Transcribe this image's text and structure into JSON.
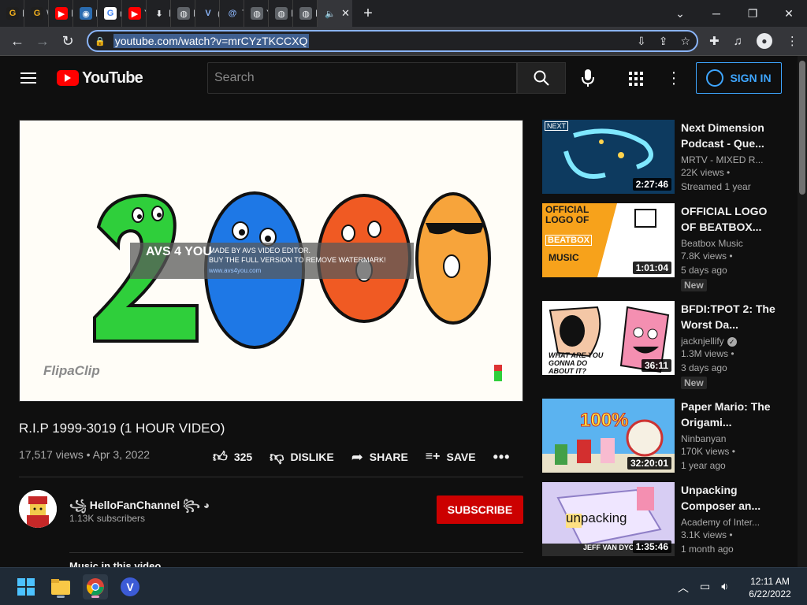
{
  "browser": {
    "tabs": [
      {
        "label": "M",
        "fav": "G",
        "favbg": "#1f1f1f",
        "favcolor": "#f2b01e"
      },
      {
        "label": "W",
        "fav": "G",
        "favbg": "#1f1f1f",
        "favcolor": "#f2b01e"
      },
      {
        "label": "M",
        "fav": "▶",
        "favbg": "#ff0000",
        "favcolor": "#ffffff"
      },
      {
        "label": "Pr",
        "fav": "◉",
        "favbg": "#2b6cb0",
        "favcolor": "#ffffff"
      },
      {
        "label": "m",
        "fav": "G",
        "favbg": "#ffffff",
        "favcolor": "#4285f4"
      },
      {
        "label": "Yo",
        "fav": "▶",
        "favbg": "#ff0000",
        "favcolor": "#ffffff"
      },
      {
        "label": "Do",
        "fav": "⬇",
        "favbg": "#202124",
        "favcolor": "#e8eaed"
      },
      {
        "label": "M",
        "fav": "◍",
        "favbg": "#5f6368",
        "favcolor": "#e8eaed"
      },
      {
        "label": "(1",
        "fav": "V",
        "favbg": "#202124",
        "favcolor": "#8ab4f8"
      },
      {
        "label": "Te",
        "fav": "@",
        "favbg": "#202124",
        "favcolor": "#8ab4f8"
      },
      {
        "label": "Yo",
        "fav": "◍",
        "favbg": "#5f6368",
        "favcolor": "#e8eaed"
      },
      {
        "label": "Re",
        "fav": "◍",
        "favbg": "#5f6368",
        "favcolor": "#e8eaed"
      },
      {
        "label": "Lo",
        "fav": "◍",
        "favbg": "#5f6368",
        "favcolor": "#e8eaed"
      }
    ],
    "active_tab_close": "✕",
    "new_tab": "+",
    "url": "youtube.com/watch?v=mrCYzTKCCXQ"
  },
  "yt": {
    "logo_text": "YouTube",
    "search_placeholder": "Search",
    "signin_label": "SIGN IN"
  },
  "video": {
    "watermark_line1": "MADE BY AVS VIDEO EDITOR.",
    "watermark_line2": "BUY THE FULL VERSION TO REMOVE WATERMARK!",
    "watermark_url": "www.avs4you.com",
    "watermark_logo": "AVS 4 YOU",
    "flipaclip": "FlipaClip",
    "title": "R.I.P 1999-3019 (1 HOUR VIDEO)",
    "views": "17,517 views",
    "date": "Apr 3, 2022",
    "likes": "325",
    "dislike_label": "DISLIKE",
    "share_label": "SHARE",
    "save_label": "SAVE",
    "channel_name": "HelloFanChannel",
    "subscribers": "1.13K subscribers",
    "subscribe_label": "SUBSCRIBE",
    "music_heading": "Music in this video"
  },
  "recommendations": [
    {
      "title": "Next Dimension Podcast - Que...",
      "channel": "MRTV - MIXED R...",
      "views": "22K views •",
      "age": "Streamed 1 year",
      "duration": "2:27:46",
      "badge": "",
      "verified": false
    },
    {
      "title": "OFFICIAL LOGO OF BEATBOX...",
      "channel": "Beatbox Music",
      "views": "7.8K views •",
      "age": "5 days ago",
      "duration": "1:01:04",
      "badge": "New",
      "verified": false
    },
    {
      "title": "BFDI:TPOT 2: The Worst Da...",
      "channel": "jacknjellify",
      "views": "1.3M views •",
      "age": "3 days ago",
      "duration": "36:11",
      "badge": "New",
      "verified": true
    },
    {
      "title": "Paper Mario: The Origami...",
      "channel": "Ninbanyan",
      "views": "170K views •",
      "age": "1 year ago",
      "duration": "32:20:01",
      "badge": "",
      "verified": false
    },
    {
      "title": "Unpacking Composer an...",
      "channel": "Academy of Inter...",
      "views": "3.1K views •",
      "age": "1 month ago",
      "duration": "1:35:46",
      "badge": "",
      "verified": false
    }
  ],
  "thumb_text": {
    "next_logo": "NEXT",
    "beatbox_official": "OFFICIAL LOGO OF",
    "beatbox_word": "BEATBOX",
    "beatbox_music": "MUSIC",
    "bfdi_caption": "WHAT ARE YOU GONNA DO ABOUT IT?",
    "mario_pct": "100%",
    "unpacking_word": "unpacking",
    "unpacking_name": "JEFF VAN DYCK"
  },
  "taskbar": {
    "time": "12:11 AM",
    "date": "6/22/2022"
  }
}
